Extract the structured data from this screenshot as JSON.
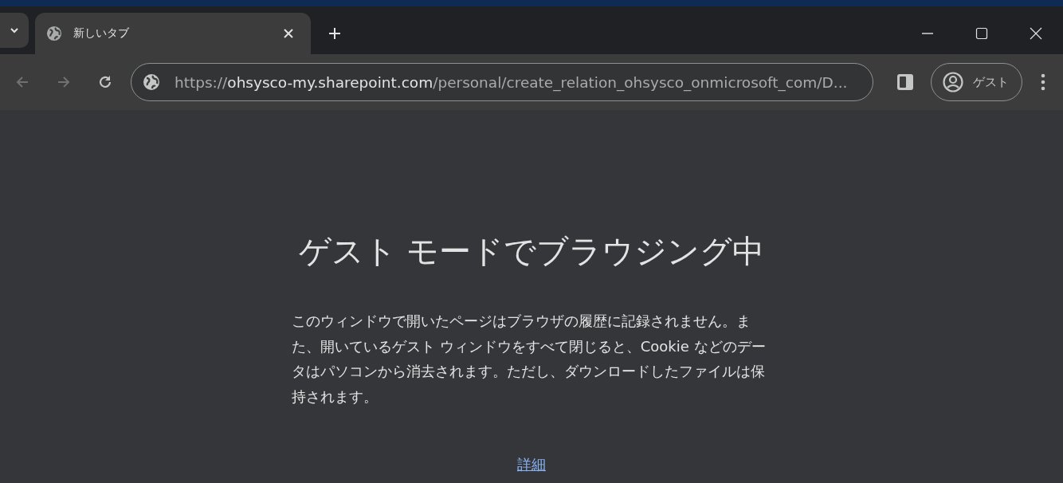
{
  "tabs": [
    {
      "title": "新しいタブ",
      "selected": true
    }
  ],
  "address_bar": {
    "scheme": "https://",
    "host": "ohsysco-my.sharepoint.com",
    "path": "/personal/create_relation_ohsysco_onmicrosoft_com/D..."
  },
  "navigation": {
    "back_disabled": true,
    "forward_disabled": true
  },
  "profile": {
    "label": "ゲスト"
  },
  "page": {
    "heading": "ゲスト モードでブラウジング中",
    "description": "このウィンドウで開いたページはブラウザの履歴に記録されません。また、開いているゲスト ウィンドウをすべて閉じると、Cookie などのデータはパソコンから消去されます。ただし、ダウンロードしたファイルは保持されます。",
    "link": "詳細"
  }
}
